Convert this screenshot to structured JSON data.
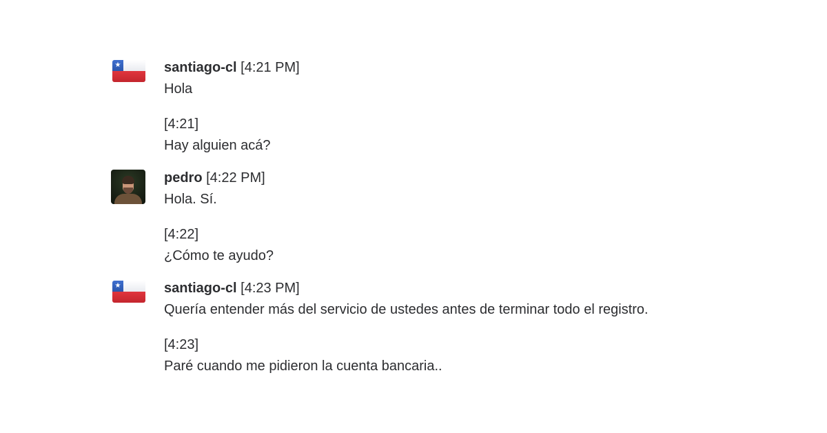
{
  "messages": [
    {
      "author": "santiago-cl",
      "time": "[4:21 PM]",
      "avatar_icon": "chile-flag-icon",
      "text": "Hola",
      "followup": {
        "time": "[4:21]",
        "text": "Hay alguien acá?"
      }
    },
    {
      "author": "pedro",
      "time": "[4:22 PM]",
      "avatar_icon": "user-photo",
      "text": "Hola. Sí.",
      "followup": {
        "time": "[4:22]",
        "text": "¿Cómo te ayudo?"
      }
    },
    {
      "author": "santiago-cl",
      "time": "[4:23 PM]",
      "avatar_icon": "chile-flag-icon",
      "text": "Quería entender más del servicio de ustedes antes de terminar todo el registro.",
      "followup": {
        "time": "[4:23]",
        "text": "Paré cuando me pidieron la cuenta bancaria.."
      }
    }
  ],
  "colors": {
    "text": "#2c2d30",
    "background": "#ffffff",
    "flag_blue": "#2b57ad",
    "flag_red": "#d32f37"
  }
}
